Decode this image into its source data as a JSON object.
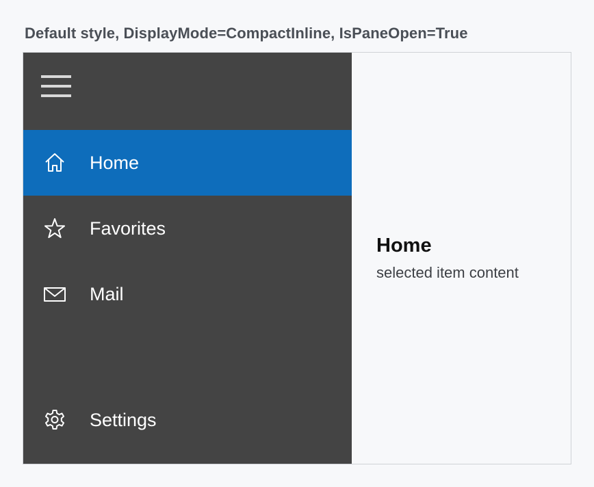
{
  "caption": "Default style, DisplayMode=CompactInline, IsPaneOpen=True",
  "pane": {
    "toggle_icon": "hamburger-menu-icon",
    "items": [
      {
        "label": "Home",
        "icon": "home-icon",
        "selected": true
      },
      {
        "label": "Favorites",
        "icon": "star-icon",
        "selected": false
      },
      {
        "label": "Mail",
        "icon": "mail-icon",
        "selected": false
      }
    ],
    "footer_item": {
      "label": "Settings",
      "icon": "gear-icon"
    }
  },
  "content": {
    "title": "Home",
    "subtitle": "selected item content"
  },
  "colors": {
    "pane_background": "#444444",
    "selected_background": "#0e6dbb",
    "page_background": "#f7f8fa"
  }
}
